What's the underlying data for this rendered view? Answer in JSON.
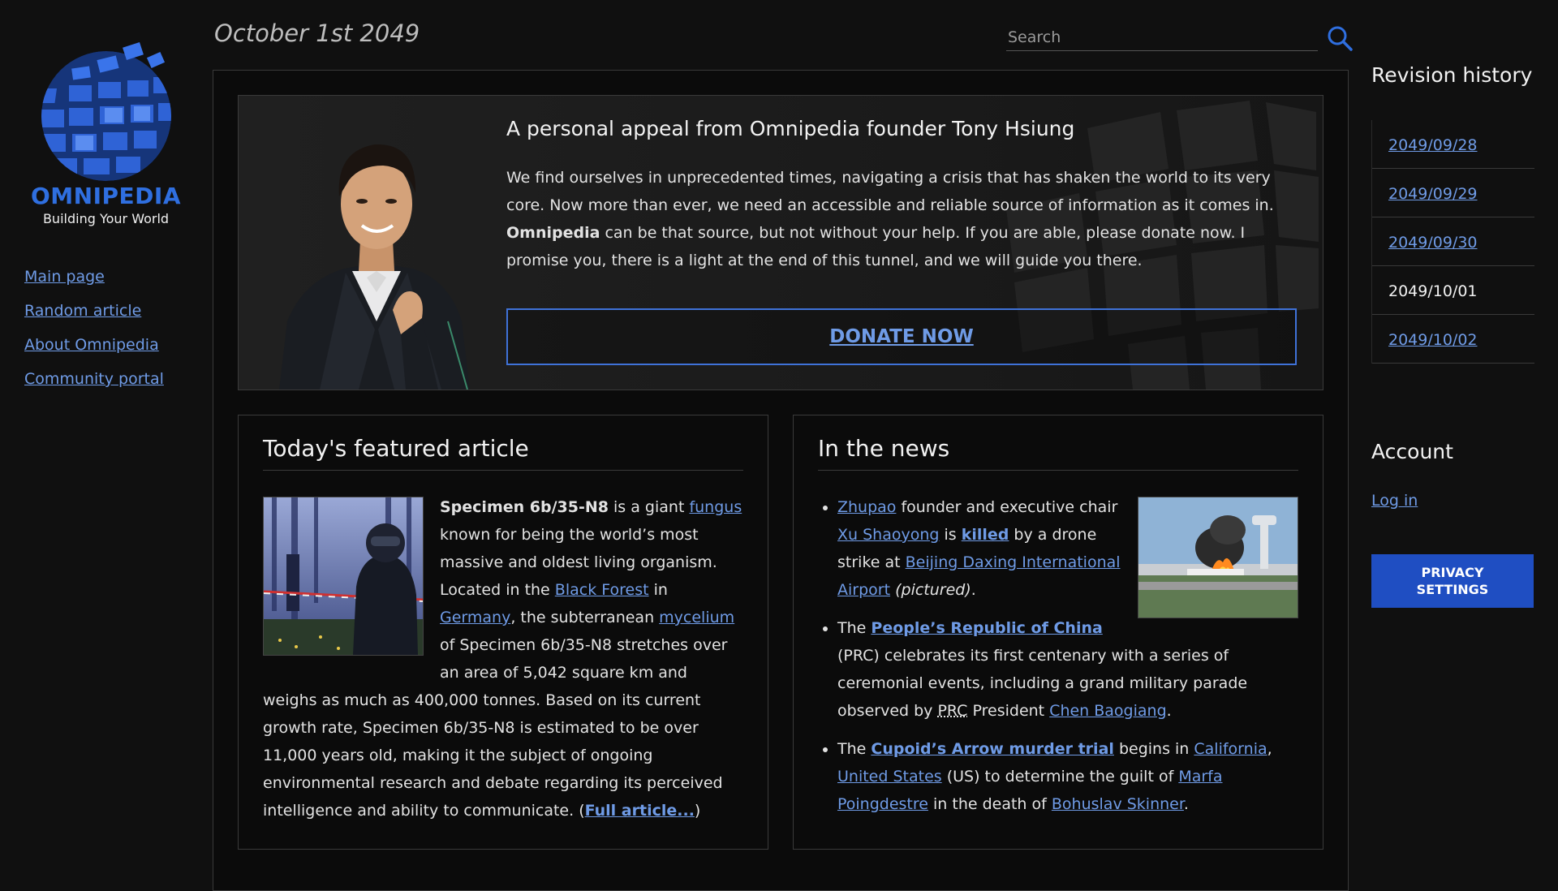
{
  "brand": {
    "name": "OMNIPEDIA",
    "tagline": "Building Your World",
    "accent": "#2f6fe0",
    "link_color": "#6f9be6"
  },
  "nav": {
    "items": [
      {
        "label": "Main page"
      },
      {
        "label": "Random article"
      },
      {
        "label": "About Omnipedia"
      },
      {
        "label": "Community portal"
      }
    ]
  },
  "header": {
    "date": "October 1st 2049",
    "search_placeholder": "Search",
    "search_value": "",
    "search_icon": "search-icon"
  },
  "appeal": {
    "title": "A personal appeal from Omnipedia founder Tony Hsiung",
    "body_1": "We find ourselves in unprecedented times, navigating a crisis that has shaken the world to its very core. Now more than ever, we need an accessible and reliable source of information as it comes in. ",
    "body_bold": "Omnipedia",
    "body_2": " can be that source, but not without your help. If you are able, please donate now. I promise you, there is a light at the end of this tunnel, and we will guide you there.",
    "donate_label": "DONATE NOW"
  },
  "featured": {
    "heading": "Today's featured article",
    "subject": "Specimen 6b/35-N8",
    "t1": " is a giant ",
    "l_fungus": "fungus",
    "t2": " known for being the world’s most massive and oldest living organism. Located in the ",
    "l_black_forest": "Black Forest",
    "t3": " in ",
    "l_germany": "Germany",
    "t4": ", the subterranean ",
    "l_mycelium": "mycelium",
    "t5": " of Specimen 6b/35-N8 stretches over an area of 5,042 square km and weighs as much as 400,000 tonnes. Based on its current growth rate, Specimen 6b/35-N8 is estimated to be over 11,000 years old, making it the subject of ongoing environmental research and debate regarding its perceived intelligence and ability to communicate. (",
    "full_article": "Full article...",
    "t6": ")"
  },
  "news": {
    "heading": "In the news",
    "item1": {
      "l_zhupao": "Zhupao",
      "t1": " founder and executive chair ",
      "l_xu": "Xu Shaoyong",
      "t2": " is ",
      "l_killed": "killed",
      "t3": " by a drone strike at ",
      "l_airport": "Beijing Daxing International Airport",
      "t4": " ",
      "pictured": "(pictured)",
      "t5": "."
    },
    "item2": {
      "t1": "The ",
      "l_prc": "People’s Republic of China",
      "t2": " (PRC) celebrates its first centenary with a series of ceremonial events, including a grand military parade observed by ",
      "abbr_prc": "PRC",
      "t3": " President ",
      "l_chen": "Chen Baogiang",
      "t4": "."
    },
    "item3": {
      "t1": "The ",
      "l_trial": "Cupoid’s Arrow murder trial",
      "t2": " begins in ",
      "l_california": "California",
      "t3": ", ",
      "l_us": "United States",
      "t4": " (US) to determine the guilt of ",
      "l_marfa": "Marfa Poingdestre",
      "t5": " in the death of ",
      "l_bohuslav": "Bohuslav Skinner",
      "t6": "."
    }
  },
  "revisions": {
    "title": "Revision history",
    "items": [
      {
        "label": "2049/09/28",
        "current": false
      },
      {
        "label": "2049/09/29",
        "current": false
      },
      {
        "label": "2049/09/30",
        "current": false
      },
      {
        "label": "2049/10/01",
        "current": true
      },
      {
        "label": "2049/10/02",
        "current": false
      }
    ]
  },
  "account": {
    "title": "Account",
    "login": "Log in",
    "privacy_button": "PRIVACY SETTINGS"
  }
}
